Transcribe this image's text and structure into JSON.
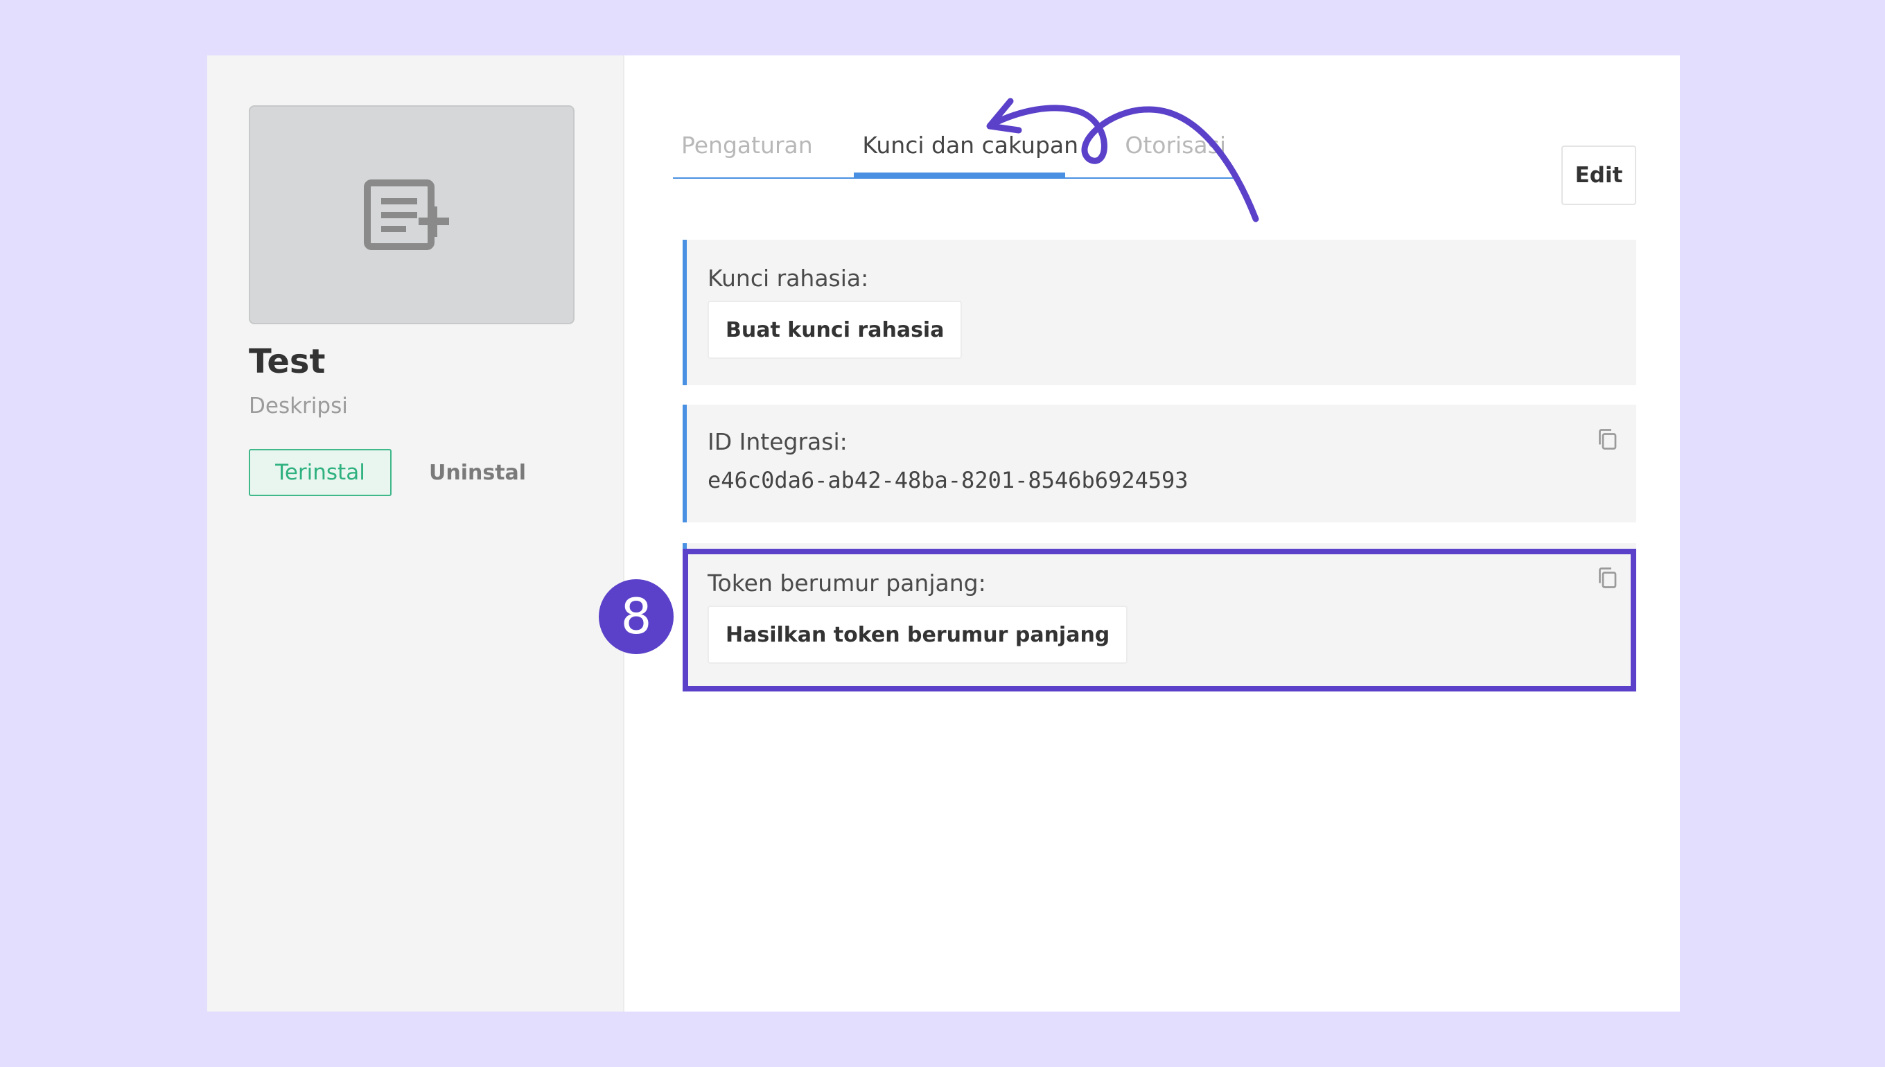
{
  "app": {
    "name": "Test",
    "description": "Deskripsi",
    "installed_label": "Terinstal",
    "uninstall_label": "Uninstal"
  },
  "tabs": [
    {
      "label": "Pengaturan",
      "active": false
    },
    {
      "label": "Kunci dan cakupan",
      "active": true
    },
    {
      "label": "Otorisasi",
      "active": false
    }
  ],
  "edit_label": "Edit",
  "secret_key": {
    "label": "Kunci rahasia:",
    "button_label": "Buat kunci rahasia"
  },
  "integration": {
    "label": "ID Integrasi:",
    "id_value": "e46c0da6-ab42-48ba-8201-8546b6924593",
    "copy_icon": "copy-icon"
  },
  "long_token": {
    "label": "Token berumur panjang:",
    "button_label": "Hasilkan token berumur panjang",
    "copy_icon": "copy-icon"
  },
  "step_badge": "8",
  "colors": {
    "accent": "#4a90e2",
    "highlight": "#5b40c9",
    "installed": "#2eb17e",
    "background": "#e3defd"
  }
}
